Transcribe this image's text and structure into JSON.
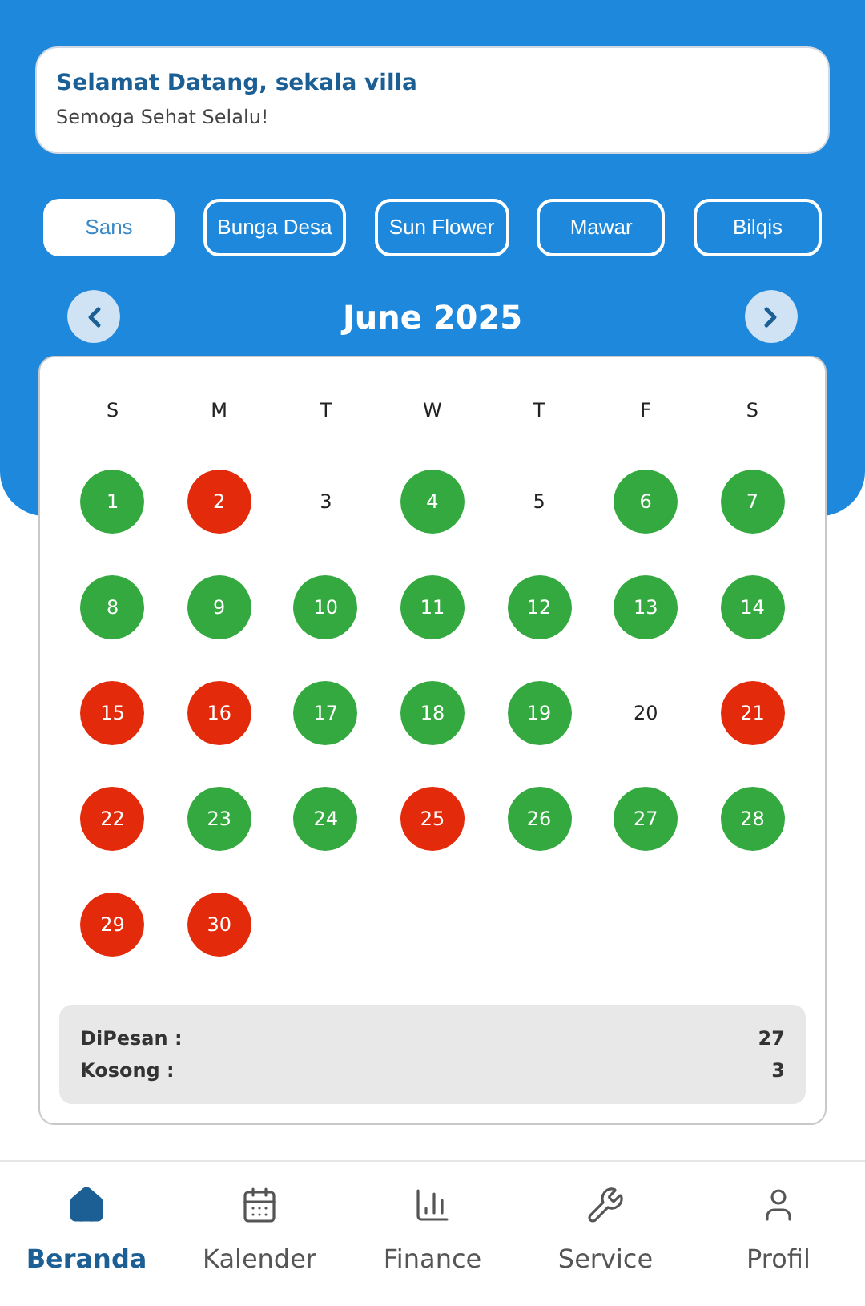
{
  "greeting": {
    "title": "Selamat Datang, sekala villa",
    "subtitle": "Semoga Sehat Selalu!"
  },
  "villas": [
    {
      "label": "Sans",
      "selected": true
    },
    {
      "label": "Bunga Desa",
      "selected": false
    },
    {
      "label": "Sun Flower",
      "selected": false
    },
    {
      "label": "Mawar",
      "selected": false
    },
    {
      "label": "Bilqis",
      "selected": false
    }
  ],
  "calendar": {
    "month": "June 2025",
    "weekdays": [
      "S",
      "M",
      "T",
      "W",
      "T",
      "F",
      "S"
    ],
    "days": [
      {
        "day": "1",
        "color": "#34a93f"
      },
      {
        "day": "2",
        "color": "#e32a0a"
      },
      {
        "day": "3"
      },
      {
        "day": "4",
        "color": "#34a93f"
      },
      {
        "day": "5"
      },
      {
        "day": "6",
        "color": "#34a93f"
      },
      {
        "day": "7",
        "color": "#34a93f"
      },
      {
        "day": "8",
        "color": "#34a93f"
      },
      {
        "day": "9",
        "color": "#34a93f"
      },
      {
        "day": "10",
        "color": "#34a93f"
      },
      {
        "day": "11",
        "color": "#34a93f"
      },
      {
        "day": "12",
        "color": "#34a93f"
      },
      {
        "day": "13",
        "color": "#34a93f"
      },
      {
        "day": "14",
        "color": "#34a93f"
      },
      {
        "day": "15",
        "color": "#e32a0a"
      },
      {
        "day": "16",
        "color": "#e32a0a"
      },
      {
        "day": "17",
        "color": "#34a93f"
      },
      {
        "day": "18",
        "color": "#34a93f"
      },
      {
        "day": "19",
        "color": "#34a93f"
      },
      {
        "day": "20"
      },
      {
        "day": "21",
        "color": "#e32a0a"
      },
      {
        "day": "22",
        "color": "#e32a0a"
      },
      {
        "day": "23",
        "color": "#34a93f"
      },
      {
        "day": "24",
        "color": "#34a93f"
      },
      {
        "day": "25",
        "color": "#e32a0a"
      },
      {
        "day": "26",
        "color": "#34a93f"
      },
      {
        "day": "27",
        "color": "#34a93f"
      },
      {
        "day": "28",
        "color": "#34a93f"
      },
      {
        "day": "29",
        "color": "#e32a0a"
      },
      {
        "day": "30",
        "color": "#e32a0a"
      }
    ],
    "summary": [
      {
        "label": "DiPesan :",
        "value": "27"
      },
      {
        "label": "Kosong :",
        "value": "3"
      }
    ]
  },
  "nav": [
    {
      "kind": "home",
      "label": "Beranda",
      "selected": true
    },
    {
      "kind": "calendar",
      "label": "Kalender",
      "selected": false
    },
    {
      "kind": "chart",
      "label": "Finance",
      "selected": false
    },
    {
      "kind": "wrench",
      "label": "Service",
      "selected": false
    },
    {
      "kind": "user",
      "label": "Profil",
      "selected": false
    }
  ]
}
